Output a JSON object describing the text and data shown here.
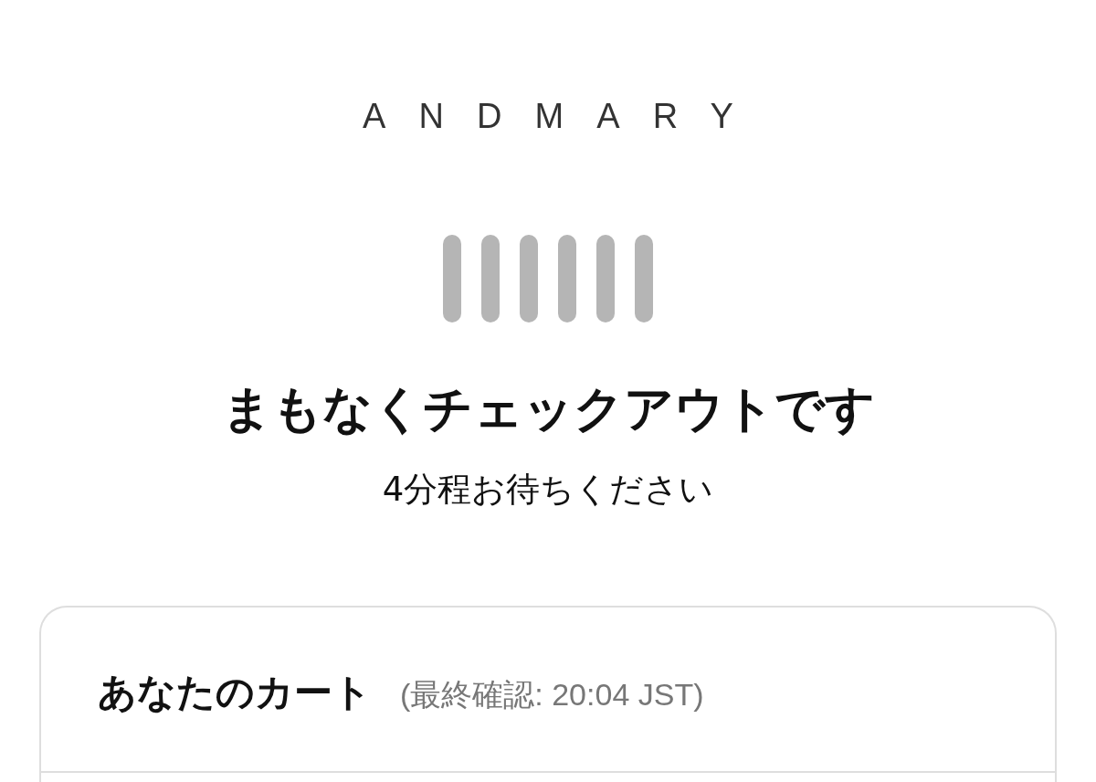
{
  "header": {
    "logo": "ANDMARY"
  },
  "status": {
    "title": "まもなくチェックアウトです",
    "subtitle": "4分程お待ちください"
  },
  "cart": {
    "title": "あなたのカート",
    "last_checked": "(最終確認: 20:04 JST)"
  }
}
